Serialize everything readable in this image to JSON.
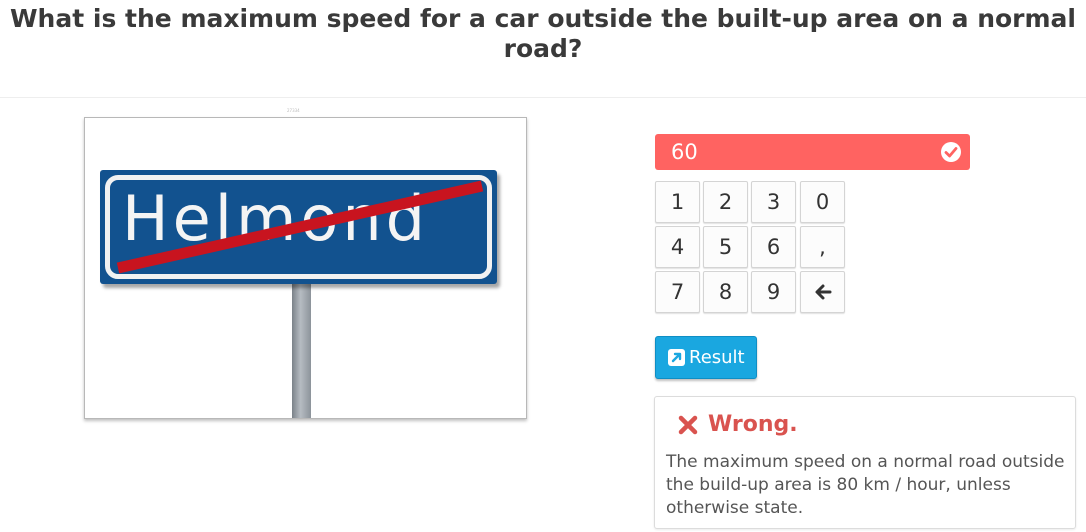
{
  "question": "What is the maximum speed for a car outside the built-up area on a normal road?",
  "image": {
    "caption": "27334",
    "sign_text": "Helmond",
    "icons": [
      "city-sign-end-illustration"
    ]
  },
  "answer": {
    "value": "60",
    "status_icon": "check-circle-icon",
    "background_color": "#ff6361"
  },
  "keypad": {
    "keys": [
      "1",
      "2",
      "3",
      "0",
      "4",
      "5",
      "6",
      ",",
      "7",
      "8",
      "9",
      "backspace"
    ]
  },
  "result_button": {
    "label": "Result",
    "icon": "external-link-icon",
    "color": "#1aa7e0"
  },
  "feedback": {
    "title": "Wrong.",
    "icon": "cross-icon",
    "text": "The maximum speed on a normal road outside the build-up area is 80 km / hour, unless otherwise state.",
    "title_color": "#d9534f"
  }
}
